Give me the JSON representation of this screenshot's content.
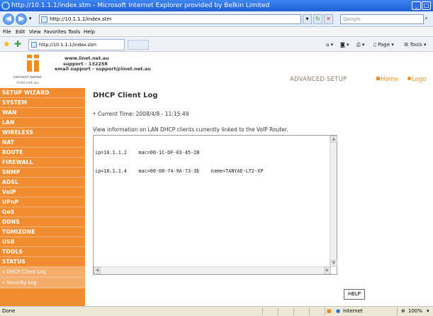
{
  "window": {
    "title": "http://10.1.1.1/index.stm - Microsoft Internet Explorer provided by Belkin Limited",
    "url": "http://10.1.1.1/index.stm",
    "search_placeholder": "Google",
    "tab_title": "http://10.1.1.1/index.stm"
  },
  "menu": [
    "File",
    "Edit",
    "View",
    "Favorites",
    "Tools",
    "Help"
  ],
  "commands": {
    "page": "Page",
    "tools": "Tools"
  },
  "header": {
    "logo_caption": "connect better",
    "logo_site": "iinet.net.au",
    "contact_lines": [
      "www.iinet.net.au",
      "support - 132258",
      "email support - support@iinet.net.au"
    ],
    "advanced_setup": "ADVANCED SETUP",
    "home": "Home",
    "logout": "Logo"
  },
  "sidebar": {
    "items": [
      "SETUP WIZARD",
      "SYSTEM",
      "WAN",
      "LAN",
      "WIRELESS",
      "NAT",
      "ROUTE",
      "FIREWALL",
      "SNMP",
      "ADSL",
      "VoIP",
      "UPnP",
      "QoS",
      "DDNS",
      "TOMIZONE",
      "USB",
      "TOOLS",
      "STATUS"
    ],
    "sub_items": [
      "» DHCP Client Log",
      "» Security Log"
    ]
  },
  "content": {
    "title": "DHCP Client Log",
    "current_time": "• Current Time: 2008/4/8 - 11:15:49",
    "info": "View information on LAN DHCP clients currently linked to the VoIP Router.",
    "log_lines": [
      "ip=10.1.1.2    mac=00-1C-DF-03-45-2B",
      "ip=10.1.1.4    mac=00-08-74-9A-73-3E    name=TANYAE-LT2-XP"
    ],
    "help": "HELP"
  },
  "statusbar": {
    "left": "Done",
    "zone": "Internet",
    "zoom": "100%"
  }
}
